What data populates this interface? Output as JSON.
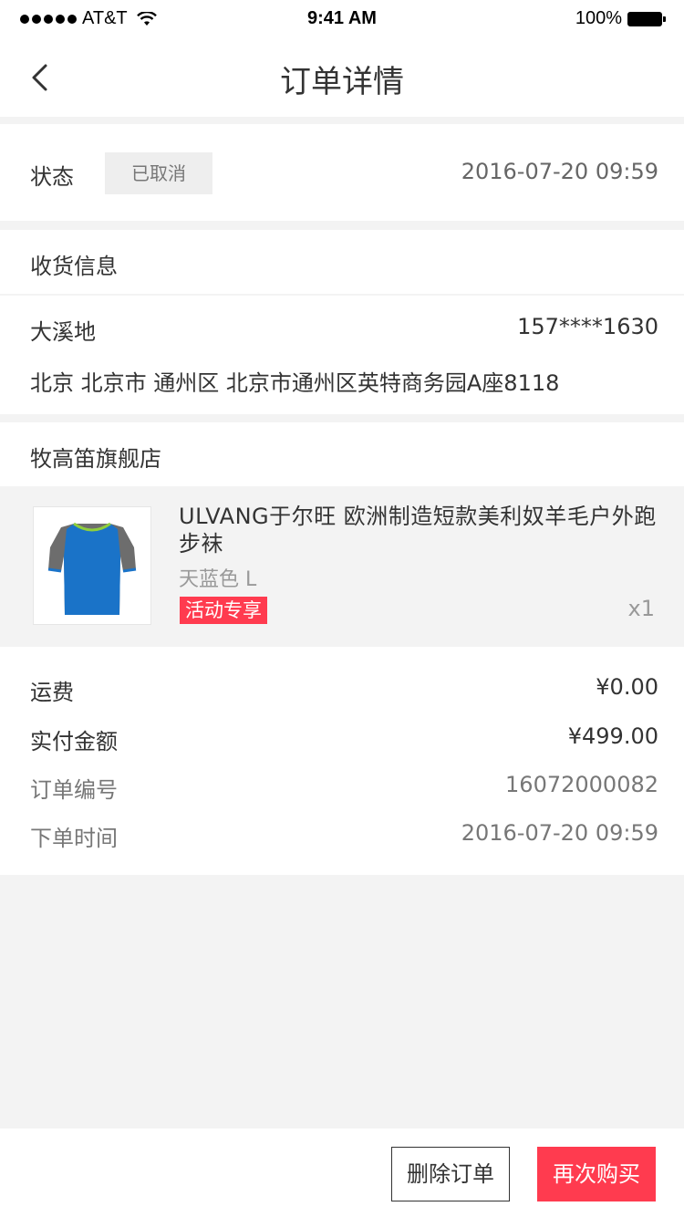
{
  "status_bar": {
    "carrier": "AT&T",
    "time": "9:41 AM",
    "battery": "100%"
  },
  "nav": {
    "title": "订单详情"
  },
  "order_status": {
    "label": "状态",
    "badge": "已取消",
    "time": "2016-07-20 09:59"
  },
  "shipping": {
    "title": "收货信息",
    "name": "大溪地",
    "phone": "157****1630",
    "address": "北京 北京市 通州区 北京市通州区英特商务园A座8118"
  },
  "store": {
    "name": "牧高笛旗舰店"
  },
  "product": {
    "title": "ULVANG于尔旺 欧洲制造短款美利奴羊毛户外跑步袜",
    "variant": "天蓝色   L",
    "tag": "活动专享",
    "qty": "x1",
    "colors": {
      "shirt_body": "#1a73c8",
      "shirt_sleeve": "#6d6d6d",
      "collar": "#8fcf3c"
    }
  },
  "summary": {
    "rows": [
      {
        "label": "运费",
        "value": "¥0.00"
      },
      {
        "label": "实付金额",
        "value": "¥499.00"
      },
      {
        "label": "订单编号",
        "value": "16072000082"
      },
      {
        "label": "下单时间",
        "value": "2016-07-20 09:59"
      }
    ]
  },
  "footer": {
    "delete_label": "删除订单",
    "rebuy_label": "再次购买"
  },
  "colors": {
    "accent": "#ff3b4f",
    "background": "#f3f3f3"
  }
}
